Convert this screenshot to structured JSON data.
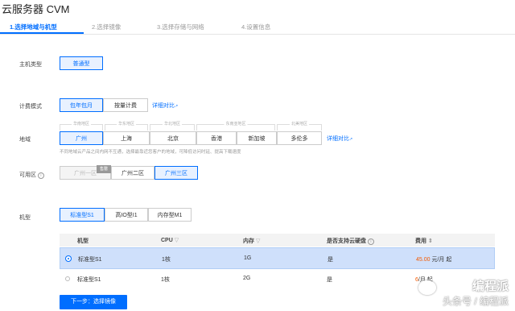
{
  "title": "云服务器 CVM",
  "steps": [
    "1.选择地域与机型",
    "2.选择镜像",
    "3.选择存储与网络",
    "4.设置信息"
  ],
  "host_type": {
    "label": "主机类型",
    "option": "普通型"
  },
  "billing": {
    "label": "计费模式",
    "options": [
      "包年包月",
      "按量计费"
    ],
    "link": "详细对比"
  },
  "region": {
    "label": "地域",
    "groups": [
      "华南地区",
      "华东地区",
      "华北地区",
      "东南亚地区",
      "北美地区"
    ],
    "options": [
      "广州",
      "上海",
      "北京",
      "香港",
      "新加坡",
      "多伦多"
    ],
    "link": "详细对比",
    "note": "不同地域云产品之间内网不互通，选择最靠近您客户的地域，可降低访问时延、提高下载速度"
  },
  "zone": {
    "label": "可用区",
    "options": [
      "广州一区",
      "广州二区",
      "广州三区"
    ],
    "badge": "售罄"
  },
  "model": {
    "label": "机型",
    "options": [
      "标准型S1",
      "高IO型I1",
      "内存型M1"
    ]
  },
  "table": {
    "headers": [
      "机型",
      "CPU",
      "内存",
      "是否支持云硬盘",
      "费用"
    ],
    "rows": [
      {
        "model": "标准型S1",
        "cpu": "1核",
        "mem": "1G",
        "disk": "是",
        "price": "45.00",
        "unit": "元/月 起"
      },
      {
        "model": "标准型S1",
        "cpu": "1核",
        "mem": "2G",
        "disk": "是",
        "price": "6",
        "unit": "/月 起"
      }
    ]
  },
  "next_button": "下一步：选择镜像",
  "watermark": {
    "line1": "编程派",
    "line2": "头条号 / 编程派"
  },
  "colors": {
    "accent": "#006eff",
    "price": "#f55a00"
  }
}
